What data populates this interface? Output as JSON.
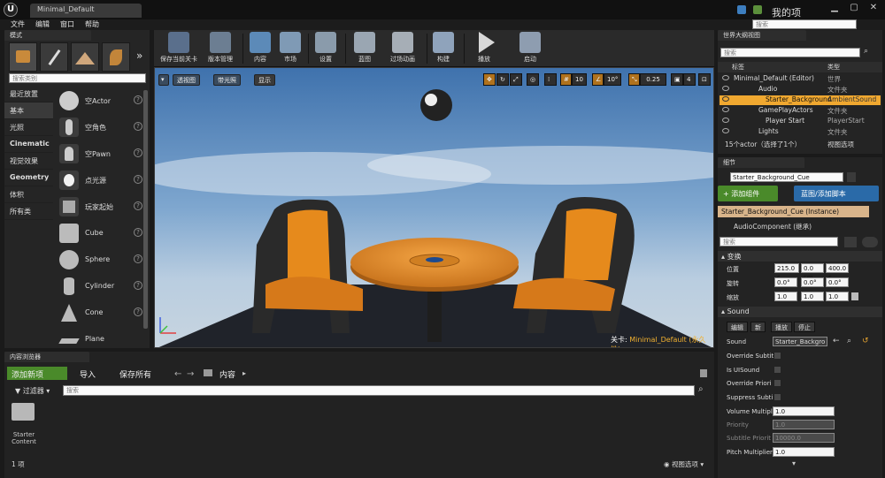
{
  "titlebar": {
    "tab": "Minimal_Default",
    "project": "我的项目7",
    "search_placeholder": "搜索"
  },
  "menu": [
    "文件",
    "编辑",
    "窗口",
    "帮助"
  ],
  "modes": {
    "tab": "模式",
    "search_placeholder": "搜索类别",
    "categories": [
      "最近放置",
      "基本",
      "光照",
      "Cinematic",
      "视觉效果",
      "Geometry",
      "体积",
      "所有类"
    ],
    "selected_category": "基本",
    "items": [
      "空Actor",
      "空角色",
      "空Pawn",
      "点光源",
      "玩家起始",
      "Cube",
      "Sphere",
      "Cylinder",
      "Cone",
      "Plane"
    ]
  },
  "toolbar": {
    "buttons": [
      "保存当前关卡",
      "版本管理",
      "内容",
      "市场",
      "设置",
      "蓝图",
      "过场动画",
      "构建",
      "播放",
      "启动"
    ]
  },
  "viewport": {
    "buttons": [
      "透视图",
      "带光照",
      "显示"
    ],
    "grid_snap": "10",
    "rot_snap": "10°",
    "scale_snap": "0.25",
    "cam_speed": "4",
    "level_prefix": "关卡:",
    "level_name": "Minimal_Default (永久性)"
  },
  "outliner": {
    "tab": "世界大纲视图",
    "search_placeholder": "搜索",
    "col_label": "标签",
    "col_type": "类型",
    "rows": [
      {
        "label": "Minimal_Default (Editor)",
        "type": "世界"
      },
      {
        "label": "Audio",
        "type": "文件夹"
      },
      {
        "label": "Starter_Background",
        "type": "AmbientSound"
      },
      {
        "label": "GamePlayActors",
        "type": "文件夹"
      },
      {
        "label": "Player Start",
        "type": "PlayerStart"
      },
      {
        "label": "Lights",
        "type": "文件夹"
      }
    ],
    "footer": "15个actor（选择了1个）",
    "view_options": "视图选项"
  },
  "details": {
    "tab": "细节",
    "name_value": "Starter_Background_Cue",
    "add_component": "+ 添加组件",
    "blueprint_btn": "蓝图/添加脚本",
    "instance": "Starter_Background_Cue (Instance)",
    "component": "AudioComponent (继承)",
    "search_placeholder": "搜索",
    "transform": {
      "title": "变换",
      "location_label": "位置",
      "rotation_label": "旋转",
      "scale_label": "缩放",
      "location": [
        "215.0 c",
        "0.0 cm",
        "400.0 c"
      ],
      "rotation": [
        "0.0°",
        "0.0°",
        "0.0°"
      ],
      "scale": [
        "1.0",
        "1.0",
        "1.0"
      ]
    },
    "sound": {
      "title": "Sound",
      "buttons": [
        "编辑",
        "新",
        "播放",
        "停止"
      ],
      "sound_label": "Sound",
      "sound_value": "Starter_Backgro",
      "props": [
        {
          "label": "Override Subtit",
          "kind": "check"
        },
        {
          "label": "Is UISound",
          "kind": "check"
        },
        {
          "label": "Override Priori",
          "kind": "check"
        },
        {
          "label": "Suppress Subti",
          "kind": "check"
        },
        {
          "label": "Volume Multipl",
          "kind": "num",
          "value": "1.0"
        },
        {
          "label": "Priority",
          "kind": "num",
          "value": "1.0",
          "disabled": true
        },
        {
          "label": "Subtitle Priorit",
          "kind": "num",
          "value": "10000.0",
          "disabled": true
        },
        {
          "label": "Pitch Multiplier",
          "kind": "num",
          "value": "1.0"
        }
      ]
    }
  },
  "content": {
    "tab": "内容浏览器",
    "add_new": "添加新项",
    "import": "导入",
    "save_all": "保存所有",
    "path": "内容",
    "filter": "过滤器",
    "search_placeholder": "搜索",
    "folder": "Starter Content",
    "count": "1 项",
    "view_options": "视图选项"
  },
  "colors": {
    "accent_green": "#4a8a2a",
    "accent_blue": "#2a6aa8",
    "selection": "#f0a830",
    "orange_snap": "#b0721d"
  }
}
